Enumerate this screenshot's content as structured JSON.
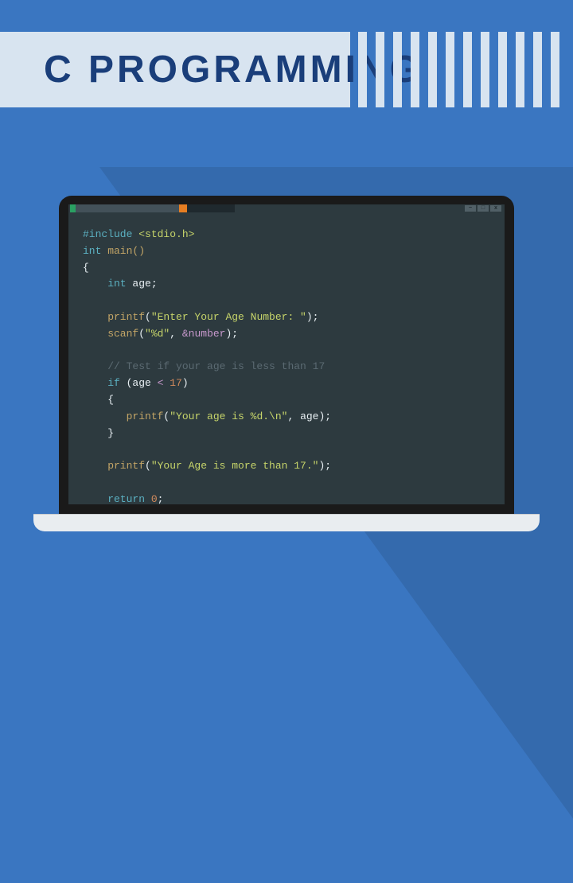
{
  "title": "C  PROGRAMMING",
  "editor": {
    "win": {
      "min": "−",
      "max": "□",
      "close": "x"
    }
  },
  "code": {
    "l1a": "#include ",
    "l1b": "<stdio.h>",
    "l2a": "int",
    "l2b": " main()",
    "l3": "{",
    "l4a": "    int",
    "l4b": " age",
    "l4c": ";",
    "blank1": "",
    "l5a": "    printf",
    "l5b": "(",
    "l5c": "\"Enter Your Age Number: \"",
    "l5d": ");",
    "l6a": "    scanf",
    "l6b": "(",
    "l6c": "\"%d\"",
    "l6d": ", ",
    "l6e": "&number",
    "l6f": ");",
    "blank2": "",
    "l7": "    // Test if your age is less than 17",
    "l8a": "    if ",
    "l8b": "(age ",
    "l8c": "<",
    "l8d": " 17",
    "l8e": ")",
    "l9": "    {",
    "l10a": "       printf",
    "l10b": "(",
    "l10c": "\"Your age is %d.\\n\"",
    "l10d": ", age);",
    "l11": "    }",
    "blank3": "",
    "l12a": "    printf",
    "l12b": "(",
    "l12c": "\"Your Age is more than 17.\"",
    "l12d": ");",
    "blank4": "",
    "l13a": "    return ",
    "l13b": "0",
    "l13c": ";",
    "l14": "}"
  }
}
